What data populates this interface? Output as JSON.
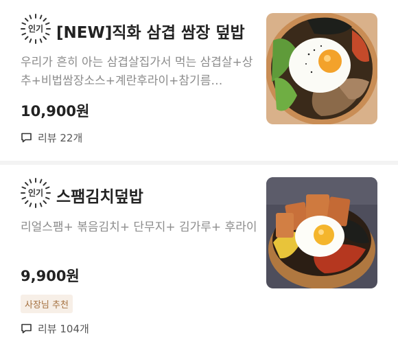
{
  "items": [
    {
      "badge": "인기",
      "title": "[NEW]직화 삼겹 쌈장 덮밥",
      "description": "우리가 흔히 아는 삼겹살집가서 먹는 삼겹살+상추+비법쌈장소스+계란후라이+참기름…",
      "price": "10,900원",
      "review": "리뷰 22개",
      "image_alt": "직화 삼겹 쌈장 덮밥 사진"
    },
    {
      "badge": "인기",
      "title": "스팸김치덮밥",
      "description": "리얼스팸+ 볶음김치+ 단무지+ 김가루+ 후라이",
      "price": "9,900원",
      "tag": "사장님 추천",
      "review": "리뷰 104개",
      "image_alt": "스팸김치덮밥 사진"
    }
  ]
}
